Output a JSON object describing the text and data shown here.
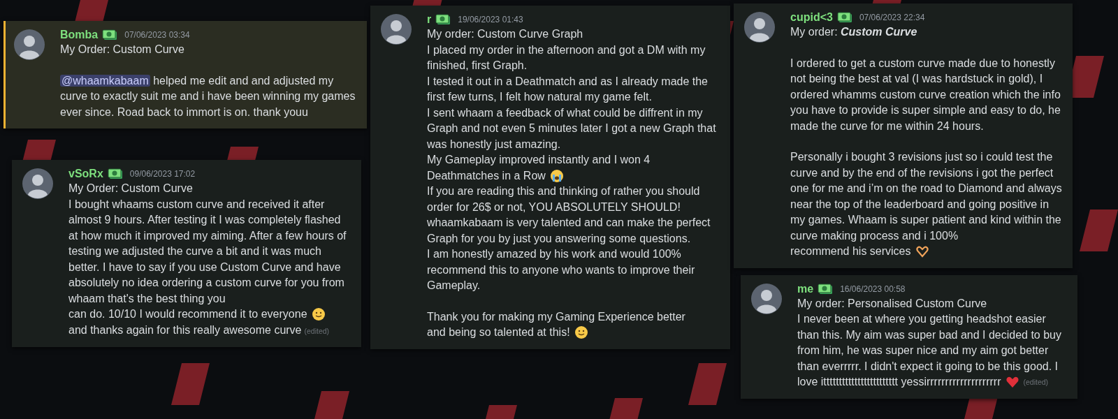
{
  "columns": [
    {
      "messages": [
        {
          "author": "Bomba",
          "timestamp": "07/06/2023 03:34",
          "highlighted": true,
          "paragraphs": [
            {
              "kind": "plain",
              "gap_before": false,
              "text": "My Order: Custom Curve"
            },
            {
              "kind": "mention",
              "gap_before": true,
              "mention": "@whaamkabaam",
              "text": " helped me edit and and adjusted my curve to exactly suit me and i have been winning my games ever since. Road back to immort is on. thank youu"
            }
          ]
        },
        {
          "author": "vSoRx",
          "timestamp": "09/06/2023 17:02",
          "highlighted": false,
          "edited_label": "(edited)",
          "paragraphs": [
            {
              "kind": "plain",
              "gap_before": false,
              "text": "My Order: Custom Curve"
            },
            {
              "kind": "smiley",
              "gap_before": false,
              "text": "I bought whaams custom curve and received it after almost 9 hours. After testing it I was completely flashed at how much it improved my aiming. After a few hours of testing we adjusted the curve a bit and it was much better. I have to say if you use Custom Curve and have absolutely no idea ordering a custom curve for you from whaam that's the best thing you",
              "text_end": "can do. 10/10 I would recommend it to everyone",
              "tail": "and thanks again for this really awesome curve"
            }
          ]
        }
      ]
    },
    {
      "messages": [
        {
          "author": "r",
          "timestamp": "19/06/2023 01:43",
          "highlighted": false,
          "paragraphs": [
            {
              "kind": "plain",
              "gap_before": false,
              "text": "My order: Custom Curve Graph"
            },
            {
              "kind": "plain",
              "gap_before": false,
              "text": "I placed my order in the afternoon and got a DM with my finished, first Graph."
            },
            {
              "kind": "plain",
              "gap_before": false,
              "text": "I tested it out in a Deathmatch and as I already made the first few turns, I felt how natural my game felt."
            },
            {
              "kind": "plain",
              "gap_before": false,
              "text": "I sent whaam a feedback of what could be diffrent in my Graph and not even 5 minutes later I got a new Graph that was honestly just amazing."
            },
            {
              "kind": "crying",
              "gap_before": false,
              "text": "My Gameplay improved instantly and I won 4",
              "text_end": "Deathmatches in a Row"
            },
            {
              "kind": "plain",
              "gap_before": false,
              "text": "If you are reading this and thinking of rather you should order for 26$ or not, YOU ABSOLUTELY SHOULD!"
            },
            {
              "kind": "plain",
              "gap_before": false,
              "text": "whaamkabaam is very talented and can make the perfect Graph for you by just you answering some questions."
            },
            {
              "kind": "plain",
              "gap_before": false,
              "text": "I am honestly amazed by his work and would 100% recommend this to anyone who wants to improve their Gameplay."
            },
            {
              "kind": "smiley",
              "gap_before": true,
              "text": "Thank you for making my Gaming Experience better",
              "text_end": "and being so talented at this!"
            }
          ]
        }
      ]
    },
    {
      "messages": [
        {
          "author": "cupid<3",
          "timestamp": "07/06/2023 22:34",
          "highlighted": false,
          "paragraphs": [
            {
              "kind": "plain",
              "gap_before": false,
              "text": "My order: ",
              "emphasis": "Custom Curve"
            },
            {
              "kind": "plain",
              "gap_before": true,
              "text": "I ordered to get a custom curve made due to honestly not being the best at val (I was hardstuck in gold), I ordered whamms custom curve creation which the info you have to provide is super simple and easy to do, he made the curve for me within 24 hours."
            },
            {
              "kind": "heart-hands",
              "gap_before": true,
              "text": "Personally i bought 3 revisions just so i could test the curve and by the end of the revisions i got the perfect one for me and i’m on the road to Diamond and always near the top of the leaderboard and going positive in my games. Whaam is super patient and kind within the curve making process and i 100%",
              "text_end": "recommend his services"
            }
          ]
        },
        {
          "author": "me",
          "timestamp": "16/06/2023 00:58",
          "highlighted": false,
          "edited_label": "(edited)",
          "paragraphs": [
            {
              "kind": "plain",
              "gap_before": false,
              "text": "My order: Personalised Custom Curve"
            },
            {
              "kind": "heart",
              "gap_before": false,
              "text": "I never been at where you getting headshot easier than this. My aim was super bad and I decided to buy from him, he was super nice and my aim got better than everrrrr. I didn't expect it going to be this good. I",
              "text_end": "love itttttttttttttttttttttttt yessirrrrrrrrrrrrrrrrrrrr"
            }
          ]
        }
      ]
    }
  ]
}
